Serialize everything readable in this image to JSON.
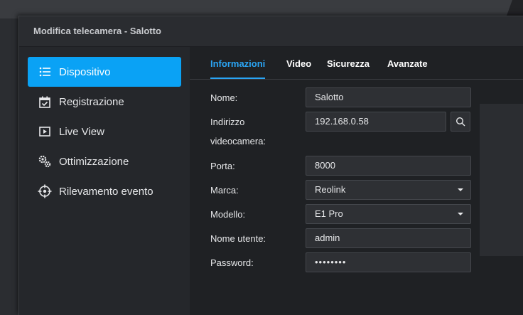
{
  "window": {
    "title": "Modifica telecamera - Salotto"
  },
  "sidebar": {
    "items": [
      {
        "label": "Dispositivo",
        "icon": "list-icon",
        "active": true
      },
      {
        "label": "Registrazione",
        "icon": "calendar-check-icon",
        "active": false
      },
      {
        "label": "Live View",
        "icon": "play-box-icon",
        "active": false
      },
      {
        "label": "Ottimizzazione",
        "icon": "gears-icon",
        "active": false
      },
      {
        "label": "Rilevamento evento",
        "icon": "crosshair-icon",
        "active": false
      }
    ]
  },
  "tabs": [
    {
      "label": "Informazioni",
      "active": true
    },
    {
      "label": "Video",
      "active": false
    },
    {
      "label": "Sicurezza",
      "active": false
    },
    {
      "label": "Avanzate",
      "active": false
    }
  ],
  "form": {
    "name_label": "Nome:",
    "name_value": "Salotto",
    "ip_label_line1": "Indirizzo",
    "ip_label_line2": "videocamera:",
    "ip_value": "192.168.0.58",
    "port_label": "Porta:",
    "port_value": "8000",
    "brand_label": "Marca:",
    "brand_value": "Reolink",
    "model_label": "Modello:",
    "model_value": "E1 Pro",
    "user_label": "Nome utente:",
    "user_value": "admin",
    "password_label": "Password:",
    "password_value": "••••••••"
  },
  "colors": {
    "accent": "#0aa2f5",
    "tab_active": "#2aa5f5"
  }
}
